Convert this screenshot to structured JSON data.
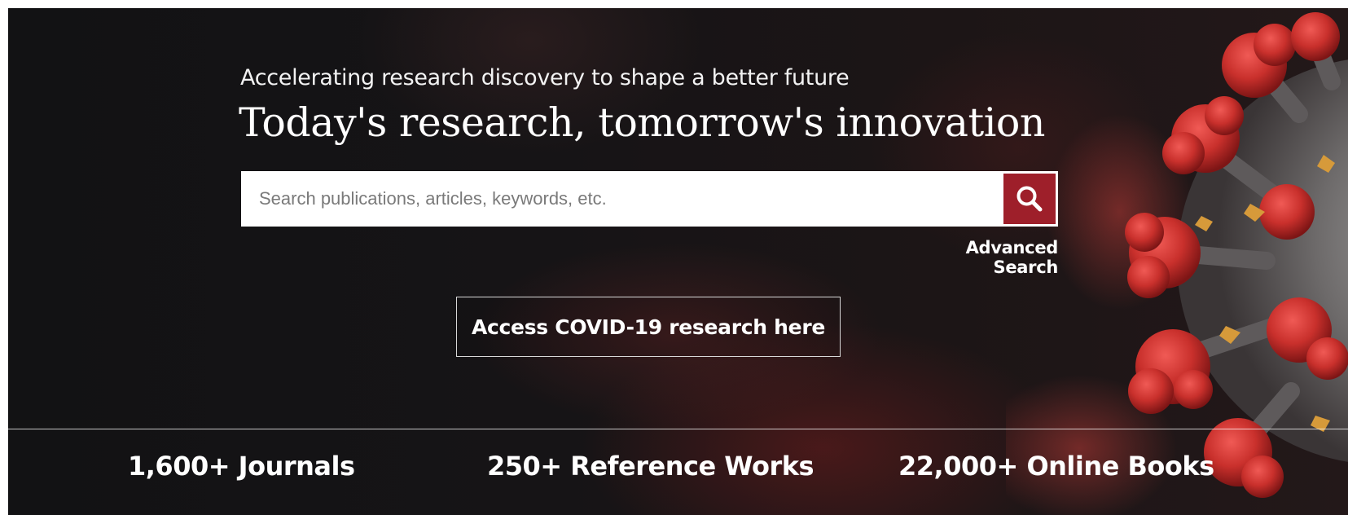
{
  "hero": {
    "tagline": "Accelerating research discovery to shape a better future",
    "headline": "Today's research, tomorrow's innovation"
  },
  "search": {
    "placeholder": "Search publications, articles, keywords, etc.",
    "button_icon": "search-icon",
    "advanced_label": "Advanced Search"
  },
  "cta": {
    "covid_label": "Access COVID-19 research here"
  },
  "stats": [
    {
      "label": "1,600+ Journals"
    },
    {
      "label": "250+ Reference Works"
    },
    {
      "label": "22,000+ Online Books"
    }
  ],
  "colors": {
    "accent": "#9e1f2a",
    "background": "#141214",
    "text": "#ffffff"
  }
}
